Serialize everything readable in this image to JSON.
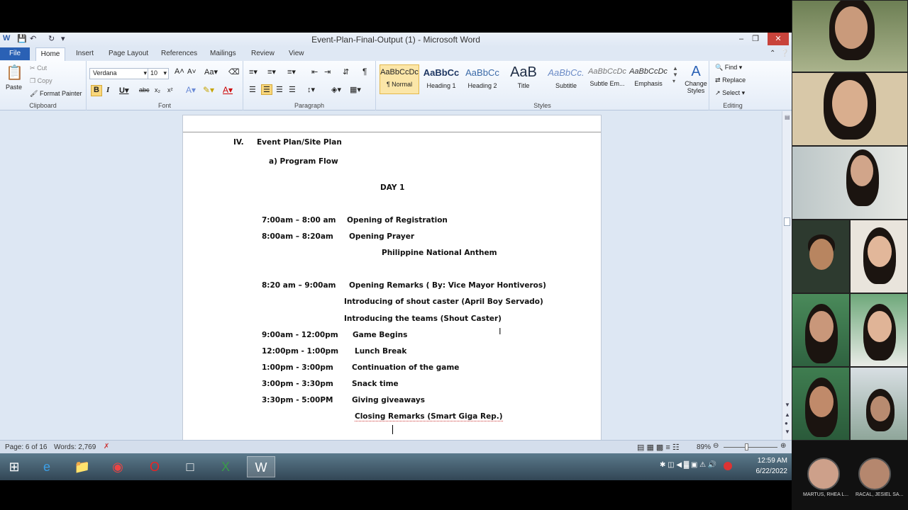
{
  "window": {
    "title": "Event-Plan-Final-Output (1)  -  Microsoft Word"
  },
  "ribbon_tabs": [
    "File",
    "Home",
    "Insert",
    "Page Layout",
    "References",
    "Mailings",
    "Review",
    "View"
  ],
  "clipboard": {
    "paste": "Paste",
    "cut": "Cut",
    "copy": "Copy",
    "format_painter": "Format Painter",
    "group": "Clipboard"
  },
  "font": {
    "name": "Verdana",
    "size": "10",
    "group": "Font"
  },
  "paragraph": {
    "group": "Paragraph"
  },
  "styles": {
    "items": [
      {
        "preview": "AaBbCcDc",
        "label": "¶ Normal"
      },
      {
        "preview": "AaBbCc",
        "label": "Heading 1"
      },
      {
        "preview": "AaBbCc",
        "label": "Heading 2"
      },
      {
        "preview": "AaB",
        "label": "Title"
      },
      {
        "preview": "AaBbCc.",
        "label": "Subtitle"
      },
      {
        "preview": "AaBbCcDc",
        "label": "Subtle Em..."
      },
      {
        "preview": "AaBbCcDc",
        "label": "Emphasis"
      }
    ],
    "change_styles": "Change Styles",
    "group": "Styles"
  },
  "editing": {
    "find": "Find",
    "replace": "Replace",
    "select": "Select",
    "group": "Editing"
  },
  "document": {
    "section": "IV.",
    "section_title": "Event Plan/Site Plan",
    "subsection": "a)  Program Flow",
    "day": "DAY 1",
    "rows": [
      {
        "time": "7:00am – 8:00 am",
        "activity": "Opening of Registration"
      },
      {
        "time": "8:00am – 8:20am",
        "activity": "Opening Prayer"
      },
      {
        "time": "",
        "activity": "Philippine National Anthem"
      },
      {
        "time": "8:20 am – 9:00am",
        "activity": "Opening Remarks ( By: Vice Mayor Hontiveros)"
      },
      {
        "time": "",
        "activity": "Introducing of shout caster (April Boy Servado)"
      },
      {
        "time": "",
        "activity": "Introducing the teams (Shout Caster)"
      },
      {
        "time": "9:00am - 12:00pm",
        "activity": "Game Begins"
      },
      {
        "time": "12:00pm - 1:00pm",
        "activity": "Lunch Break"
      },
      {
        "time": "1:00pm - 3:00pm",
        "activity": "Continuation of the game"
      },
      {
        "time": "3:00pm - 3:30pm",
        "activity": "Snack time"
      },
      {
        "time": "3:30pm - 5:00PM",
        "activity": "Giving giveaways"
      },
      {
        "time": "",
        "activity": "Closing Remarks (Smart Giga Rep.)"
      }
    ]
  },
  "status": {
    "page": "Page: 6 of 16",
    "words": "Words: 2,769",
    "zoom": "89%"
  },
  "tray": {
    "time": "12:59 AM",
    "date": "6/22/2022"
  },
  "participants": [
    {
      "name": "MARTUS, RHEA L..."
    },
    {
      "name": "RACAL, JESIEL SA..."
    }
  ]
}
